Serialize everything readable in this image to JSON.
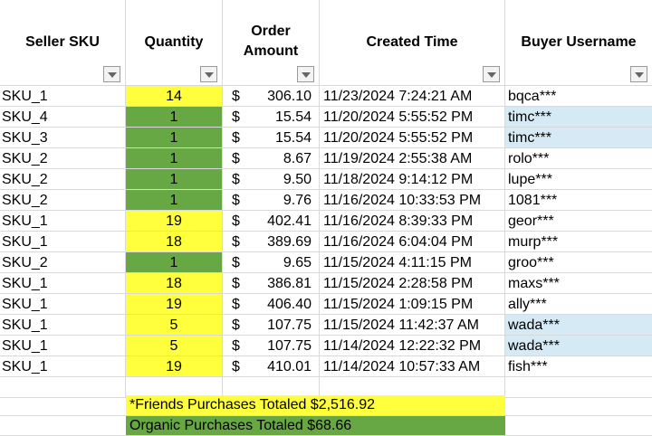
{
  "headers": {
    "sku": "Seller SKU",
    "qty": "Quantity",
    "amount_line1": "Order",
    "amount_line2": "Amount",
    "time": "Created Time",
    "user": "Buyer Username"
  },
  "currency_symbol": "$",
  "colors": {
    "yellow": "#ffff3d",
    "green": "#68a844",
    "blue": "#d5eaf5"
  },
  "rows": [
    {
      "sku": "SKU_1",
      "qty": "14",
      "amount": "306.10",
      "time": "11/23/2024 7:24:21 AM",
      "user": "bqca***",
      "qty_color": "yellow",
      "user_color": ""
    },
    {
      "sku": "SKU_4",
      "qty": "1",
      "amount": "15.54",
      "time": "11/20/2024 5:55:52 PM",
      "user": "timc***",
      "qty_color": "green",
      "user_color": "blue"
    },
    {
      "sku": "SKU_3",
      "qty": "1",
      "amount": "15.54",
      "time": "11/20/2024 5:55:52 PM",
      "user": "timc***",
      "qty_color": "green",
      "user_color": "blue"
    },
    {
      "sku": "SKU_2",
      "qty": "1",
      "amount": "8.67",
      "time": "11/19/2024 2:55:38 AM",
      "user": "rolo***",
      "qty_color": "green",
      "user_color": ""
    },
    {
      "sku": "SKU_2",
      "qty": "1",
      "amount": "9.50",
      "time": "11/18/2024 9:14:12 PM",
      "user": "lupe***",
      "qty_color": "green",
      "user_color": ""
    },
    {
      "sku": "SKU_2",
      "qty": "1",
      "amount": "9.76",
      "time": "11/16/2024 10:33:53 PM",
      "user": "1081***",
      "qty_color": "green",
      "user_color": ""
    },
    {
      "sku": "SKU_1",
      "qty": "19",
      "amount": "402.41",
      "time": "11/16/2024 8:39:33 PM",
      "user": "geor***",
      "qty_color": "yellow",
      "user_color": ""
    },
    {
      "sku": "SKU_1",
      "qty": "18",
      "amount": "389.69",
      "time": "11/16/2024 6:04:04 PM",
      "user": "murp***",
      "qty_color": "yellow",
      "user_color": ""
    },
    {
      "sku": "SKU_2",
      "qty": "1",
      "amount": "9.65",
      "time": "11/15/2024 4:11:15 PM",
      "user": "groo***",
      "qty_color": "green",
      "user_color": ""
    },
    {
      "sku": "SKU_1",
      "qty": "18",
      "amount": "386.81",
      "time": "11/15/2024 2:28:58 PM",
      "user": "maxs***",
      "qty_color": "yellow",
      "user_color": ""
    },
    {
      "sku": "SKU_1",
      "qty": "19",
      "amount": "406.40",
      "time": "11/15/2024 1:09:15 PM",
      "user": "ally***",
      "qty_color": "yellow",
      "user_color": ""
    },
    {
      "sku": "SKU_1",
      "qty": "5",
      "amount": "107.75",
      "time": "11/15/2024 11:42:37 AM",
      "user": "wada***",
      "qty_color": "yellow",
      "user_color": "blue"
    },
    {
      "sku": "SKU_1",
      "qty": "5",
      "amount": "107.75",
      "time": "11/14/2024 12:22:32 PM",
      "user": "wada***",
      "qty_color": "yellow",
      "user_color": "blue"
    },
    {
      "sku": "SKU_1",
      "qty": "19",
      "amount": "410.01",
      "time": "11/14/2024 10:57:33 AM",
      "user": "fish***",
      "qty_color": "yellow",
      "user_color": ""
    }
  ],
  "summary": {
    "friends": "*Friends Purchases Totaled $2,516.92",
    "organic": "Organic Purchases Totaled $68.66"
  }
}
